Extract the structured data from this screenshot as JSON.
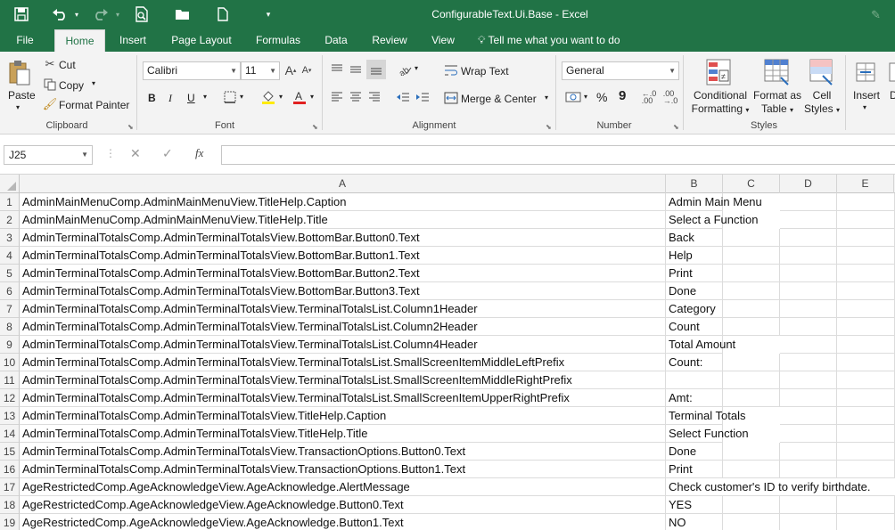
{
  "window": {
    "title": "ConfigurableText.Ui.Base - Excel"
  },
  "tabs": [
    {
      "label": "File"
    },
    {
      "label": "Home"
    },
    {
      "label": "Insert"
    },
    {
      "label": "Page Layout"
    },
    {
      "label": "Formulas"
    },
    {
      "label": "Data"
    },
    {
      "label": "Review"
    },
    {
      "label": "View"
    }
  ],
  "tell_me": "Tell me what you want to do",
  "ribbon": {
    "clipboard": {
      "paste": "Paste",
      "cut": "Cut",
      "copy": "Copy",
      "format_painter": "Format Painter",
      "label": "Clipboard"
    },
    "font": {
      "name": "Calibri",
      "size": "11",
      "label": "Font",
      "bold": "B",
      "italic": "I",
      "underline": "U"
    },
    "alignment": {
      "wrap_text": "Wrap Text",
      "merge_center": "Merge & Center",
      "label": "Alignment"
    },
    "number": {
      "format": "General",
      "percent": "%",
      "comma": "9",
      "label": "Number"
    },
    "styles": {
      "conditional": [
        "Conditional",
        "Formatting"
      ],
      "format_table": [
        "Format as",
        "Table"
      ],
      "cell_styles": [
        "Cell",
        "Styles"
      ],
      "label": "Styles"
    },
    "cells": {
      "insert": "Insert",
      "delete_partial": "D"
    }
  },
  "formula_bar": {
    "name_box": "J25",
    "fx": "fx",
    "value": ""
  },
  "columns": [
    {
      "label": ""
    },
    {
      "label": "A"
    },
    {
      "label": "B"
    },
    {
      "label": "C"
    },
    {
      "label": "D"
    },
    {
      "label": "E"
    }
  ],
  "rows": [
    {
      "num": "1",
      "a": "AdminMainMenuComp.AdminMainMenuView.TitleHelp.Caption",
      "b": "Admin Main Menu"
    },
    {
      "num": "2",
      "a": "AdminMainMenuComp.AdminMainMenuView.TitleHelp.Title",
      "b": "Select a Function"
    },
    {
      "num": "3",
      "a": "AdminTerminalTotalsComp.AdminTerminalTotalsView.BottomBar.Button0.Text",
      "b": "Back"
    },
    {
      "num": "4",
      "a": "AdminTerminalTotalsComp.AdminTerminalTotalsView.BottomBar.Button1.Text",
      "b": "Help"
    },
    {
      "num": "5",
      "a": "AdminTerminalTotalsComp.AdminTerminalTotalsView.BottomBar.Button2.Text",
      "b": "Print"
    },
    {
      "num": "6",
      "a": "AdminTerminalTotalsComp.AdminTerminalTotalsView.BottomBar.Button3.Text",
      "b": "Done"
    },
    {
      "num": "7",
      "a": "AdminTerminalTotalsComp.AdminTerminalTotalsView.TerminalTotalsList.Column1Header",
      "b": "Category"
    },
    {
      "num": "8",
      "a": "AdminTerminalTotalsComp.AdminTerminalTotalsView.TerminalTotalsList.Column2Header",
      "b": "Count"
    },
    {
      "num": "9",
      "a": "AdminTerminalTotalsComp.AdminTerminalTotalsView.TerminalTotalsList.Column4Header",
      "b": "Total Amount"
    },
    {
      "num": "10",
      "a": "AdminTerminalTotalsComp.AdminTerminalTotalsView.TerminalTotalsList.SmallScreenItemMiddleLeftPrefix",
      "b": "Count:"
    },
    {
      "num": "11",
      "a": "AdminTerminalTotalsComp.AdminTerminalTotalsView.TerminalTotalsList.SmallScreenItemMiddleRightPrefix",
      "b": ""
    },
    {
      "num": "12",
      "a": "AdminTerminalTotalsComp.AdminTerminalTotalsView.TerminalTotalsList.SmallScreenItemUpperRightPrefix",
      "b": "Amt:"
    },
    {
      "num": "13",
      "a": "AdminTerminalTotalsComp.AdminTerminalTotalsView.TitleHelp.Caption",
      "b": "Terminal Totals"
    },
    {
      "num": "14",
      "a": "AdminTerminalTotalsComp.AdminTerminalTotalsView.TitleHelp.Title",
      "b": "Select Function"
    },
    {
      "num": "15",
      "a": "AdminTerminalTotalsComp.AdminTerminalTotalsView.TransactionOptions.Button0.Text",
      "b": "Done"
    },
    {
      "num": "16",
      "a": "AdminTerminalTotalsComp.AdminTerminalTotalsView.TransactionOptions.Button1.Text",
      "b": "Print"
    },
    {
      "num": "17",
      "a": "AgeRestrictedComp.AgeAcknowledgeView.AgeAcknowledge.AlertMessage",
      "b": "Check customer's ID to verify birthdate."
    },
    {
      "num": "18",
      "a": "AgeRestrictedComp.AgeAcknowledgeView.AgeAcknowledge.Button0.Text",
      "b": "YES"
    },
    {
      "num": "19",
      "a": "AgeRestrictedComp.AgeAcknowledgeView.AgeAcknowledge.Button1.Text",
      "b": "NO"
    }
  ],
  "colors": {
    "excel_green": "#217346",
    "ribbon_bg": "#f3f3f3"
  }
}
